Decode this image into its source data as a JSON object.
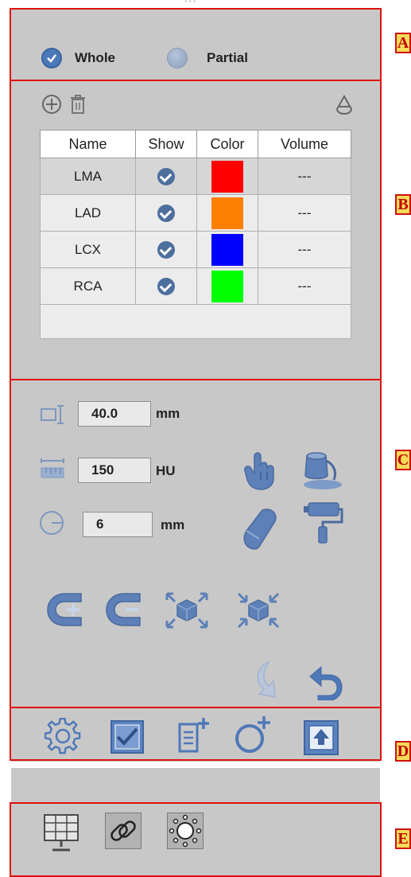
{
  "mode": {
    "whole_label": "Whole",
    "partial_label": "Partial",
    "selected": "Whole"
  },
  "table": {
    "headers": [
      "Name",
      "Show",
      "Color",
      "Volume"
    ],
    "rows": [
      {
        "name": "LMA",
        "color": "#ff0000",
        "volume": "---"
      },
      {
        "name": "LAD",
        "color": "#ff7f00",
        "volume": "---"
      },
      {
        "name": "LCX",
        "color": "#0000ff",
        "volume": "---"
      },
      {
        "name": "RCA",
        "color": "#00ff00",
        "volume": "---"
      }
    ]
  },
  "params": {
    "width_value": "40.0",
    "width_unit": "mm",
    "threshold_value": "150",
    "threshold_unit": "HU",
    "radius_value": "6",
    "radius_unit": "mm"
  },
  "section_tags": [
    "A",
    "B",
    "C",
    "D",
    "E"
  ],
  "colors": {
    "panel": "#c8c8c8",
    "accent": "#4a78b8",
    "annotation_border": "#e01010",
    "tag_fill": "#f3dc5a"
  }
}
